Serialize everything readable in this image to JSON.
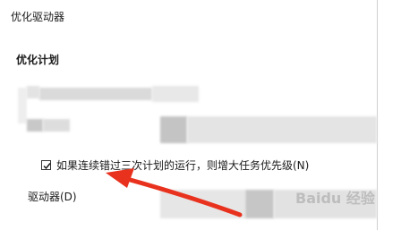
{
  "window": {
    "title": "优化驱动器"
  },
  "section": {
    "heading": "优化计划"
  },
  "checkbox": {
    "label": "如果连续错过三次计划的运行，则增大任务优先级(N)",
    "checked": true
  },
  "drives": {
    "label": "驱动器(D)"
  },
  "watermark": {
    "text": "Baidu 经验"
  },
  "colors": {
    "arrow": "#e8321e",
    "blur": "#d9d9d9"
  }
}
